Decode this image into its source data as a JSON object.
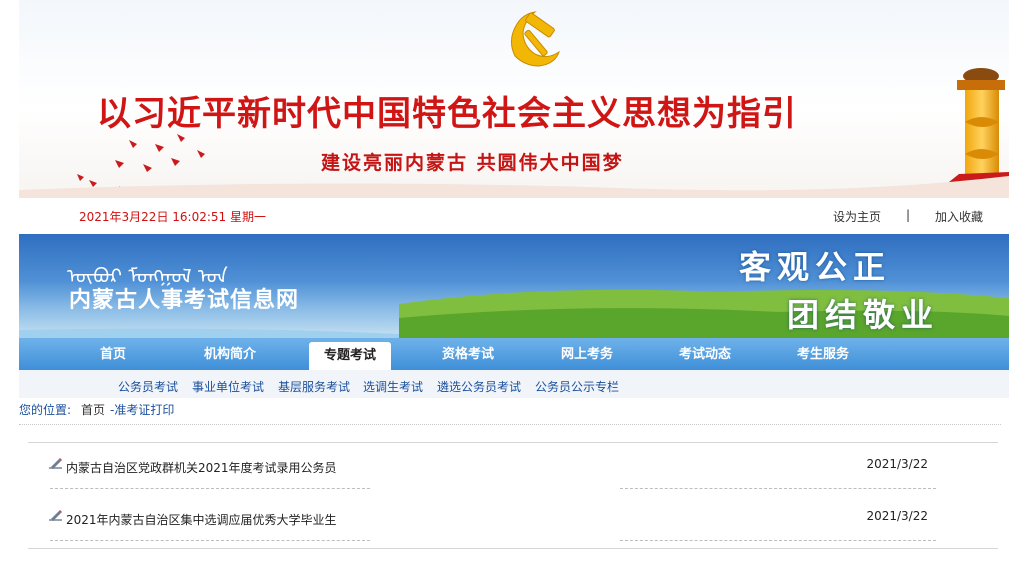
{
  "banner": {
    "slogan_main": "以习近平新时代中国特色社会主义思想为指引",
    "slogan_sub": "建设亮丽内蒙古 共圆伟大中国梦"
  },
  "info": {
    "datetime": "2021年3月22日 16:02:51 星期一",
    "set_home": "设为主页",
    "separator": "|",
    "add_favorite": "加入收藏"
  },
  "header": {
    "mongolian_script": "ᠥᠪᠦᠷ ᠮᠣᠩᠭᠤᠯ ᠤᠨ",
    "site_title": "内蒙古人事考试信息网",
    "motto_line1": "客观公正",
    "motto_line2": "团结敬业"
  },
  "nav": {
    "items": [
      "首页",
      "机构简介",
      "专题考试",
      "资格考试",
      "网上考务",
      "考试动态",
      "考生服务"
    ],
    "active": "专题考试"
  },
  "subnav": {
    "items": [
      "公务员考试",
      "事业单位考试",
      "基层服务考试",
      "选调生考试",
      "遴选公务员考试",
      "公务员公示专栏"
    ]
  },
  "breadcrumb": {
    "label": "您的位置:",
    "home": "首页",
    "current": "-准考证打印"
  },
  "listing": [
    {
      "title": "内蒙古自治区党政群机关2021年度考试录用公务员",
      "date": "2021/3/22"
    },
    {
      "title": "2021年内蒙古自治区集中选调应届优秀大学毕业生",
      "date": "2021/3/22"
    }
  ],
  "colors": {
    "accent_red": "#d01515",
    "nav_blue": "#3f8fd8",
    "link_blue": "#1a4f9c"
  }
}
